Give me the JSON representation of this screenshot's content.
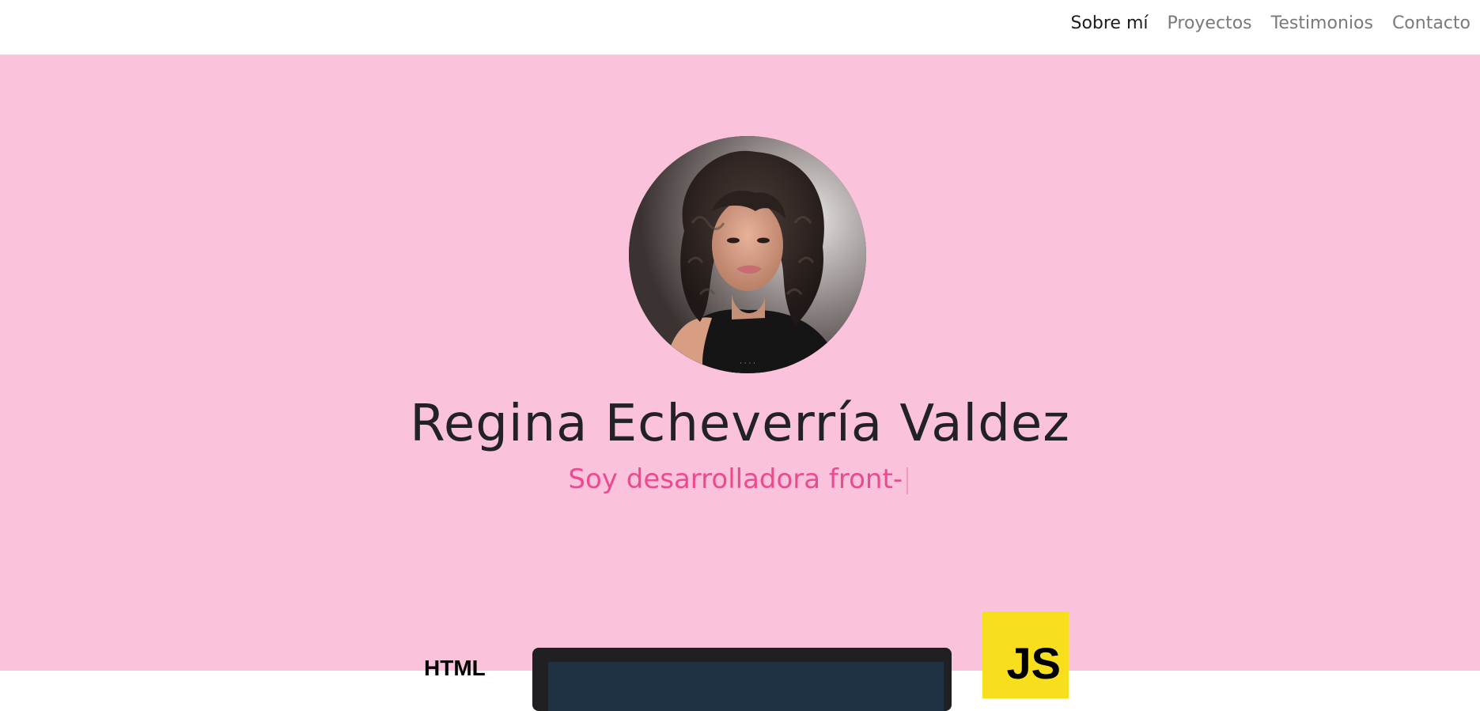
{
  "nav": {
    "items": [
      {
        "label": "Sobre mí",
        "active": true
      },
      {
        "label": "Proyectos",
        "active": false
      },
      {
        "label": "Testimonios",
        "active": false
      },
      {
        "label": "Contacto",
        "active": false
      }
    ]
  },
  "hero": {
    "name": "Regina Echeverría Valdez",
    "tagline": "Soy desarrolladora front-",
    "caret": "|"
  },
  "skills": {
    "html_label": "HTML",
    "js_label": "JS"
  },
  "colors": {
    "hero_bg": "#fbc2db",
    "tagline": "#ec4a90",
    "name": "#222226",
    "js_yellow": "#f7df1e"
  },
  "icons": [
    "profile-photo",
    "code-editor-icon",
    "javascript-logo-icon"
  ]
}
